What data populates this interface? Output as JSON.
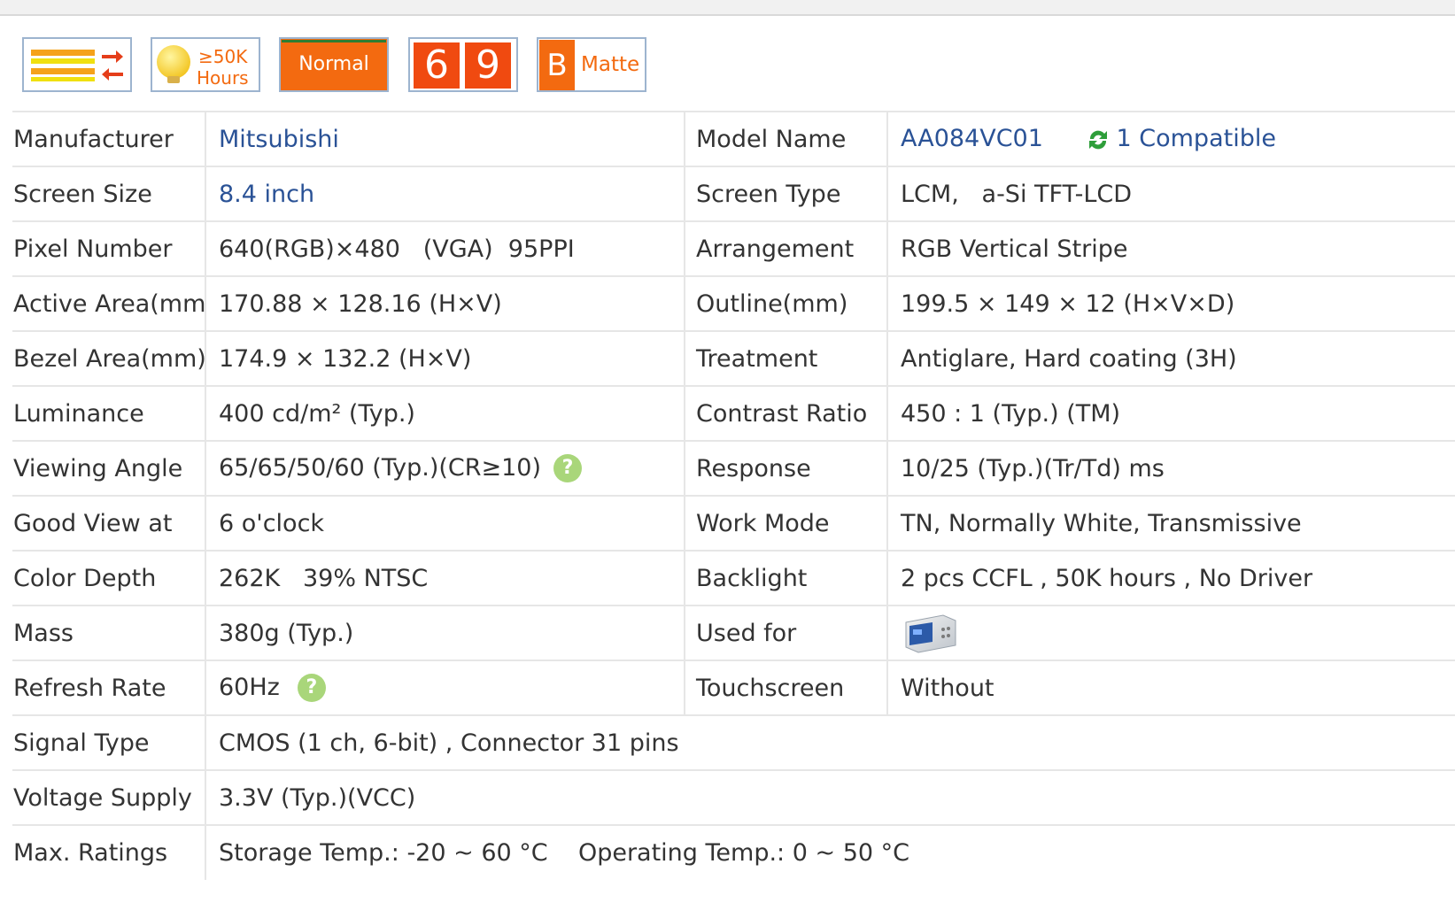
{
  "badges": [
    {
      "icon": "dual-bars-arrows-icon",
      "colors": {
        "top": "#f5a21a",
        "mid": "#f0e010",
        "arrow_top": "#e53e1a",
        "arrow_bottom": "#e53e1a"
      }
    },
    {
      "icon": "lightbulb-icon",
      "line1": "≥50K",
      "line2": "Hours"
    },
    {
      "icon": "normal-badge",
      "label": "Normal"
    },
    {
      "icon": "color-depth-badge",
      "digit1": "6",
      "digit2": "9"
    },
    {
      "icon": "matte-badge",
      "letter": "B",
      "label": "Matte"
    }
  ],
  "accent_colors": {
    "link": "#2a5296",
    "orange": "#f36a10",
    "help": "#a9d67a"
  },
  "specs": {
    "manufacturer": {
      "label": "Manufacturer",
      "value": "Mitsubishi"
    },
    "model_name": {
      "label": "Model Name",
      "value": "AA084VC01",
      "compatible": "1 Compatible"
    },
    "screen_size": {
      "label": "Screen Size",
      "value": "8.4 inch"
    },
    "screen_type": {
      "label": "Screen Type",
      "value": "LCM,   a-Si TFT-LCD"
    },
    "pixel_number": {
      "label": "Pixel Number",
      "value": "640(RGB)×480   (VGA)  95PPI"
    },
    "arrangement": {
      "label": "Arrangement",
      "value": "RGB Vertical Stripe"
    },
    "active_area": {
      "label": "Active Area(mm)",
      "value": "170.88 × 128.16 (H×V)"
    },
    "outline": {
      "label": "Outline(mm)",
      "value": "199.5 × 149 × 12 (H×V×D)"
    },
    "bezel_area": {
      "label": "Bezel Area(mm)",
      "value": "174.9 × 132.2 (H×V)"
    },
    "treatment": {
      "label": "Treatment",
      "value": "Antiglare, Hard coating (3H)"
    },
    "luminance": {
      "label": "Luminance",
      "value": "400 cd/m² (Typ.)"
    },
    "contrast_ratio": {
      "label": "Contrast Ratio",
      "value": "450 : 1 (Typ.) (TM)"
    },
    "viewing_angle": {
      "label": "Viewing Angle",
      "value": "65/65/50/60 (Typ.)(CR≥10)"
    },
    "response": {
      "label": "Response",
      "value": "10/25 (Typ.)(Tr/Td) ms"
    },
    "good_view": {
      "label": "Good View at",
      "value": "6 o'clock"
    },
    "work_mode": {
      "label": "Work Mode",
      "value": "TN, Normally White, Transmissive"
    },
    "color_depth": {
      "label": "Color Depth",
      "value": "262K   39% NTSC"
    },
    "backlight": {
      "label": "Backlight",
      "value": "2 pcs CCFL , 50K hours , No Driver"
    },
    "mass": {
      "label": "Mass",
      "value": "380g (Typ.)"
    },
    "used_for": {
      "label": "Used for",
      "icon": "oscilloscope-icon"
    },
    "refresh_rate": {
      "label": "Refresh Rate",
      "value": "60Hz"
    },
    "touchscreen": {
      "label": "Touchscreen",
      "value": "Without"
    },
    "signal_type": {
      "label": "Signal Type",
      "value": "CMOS (1 ch, 6-bit) , Connector 31 pins"
    },
    "voltage_supply": {
      "label": "Voltage Supply",
      "value": "3.3V (Typ.)(VCC)"
    },
    "max_ratings": {
      "label": "Max. Ratings",
      "value": "Storage Temp.: -20 ~ 60 °C    Operating Temp.: 0 ~ 50 °C"
    }
  },
  "help_glyph": "?"
}
